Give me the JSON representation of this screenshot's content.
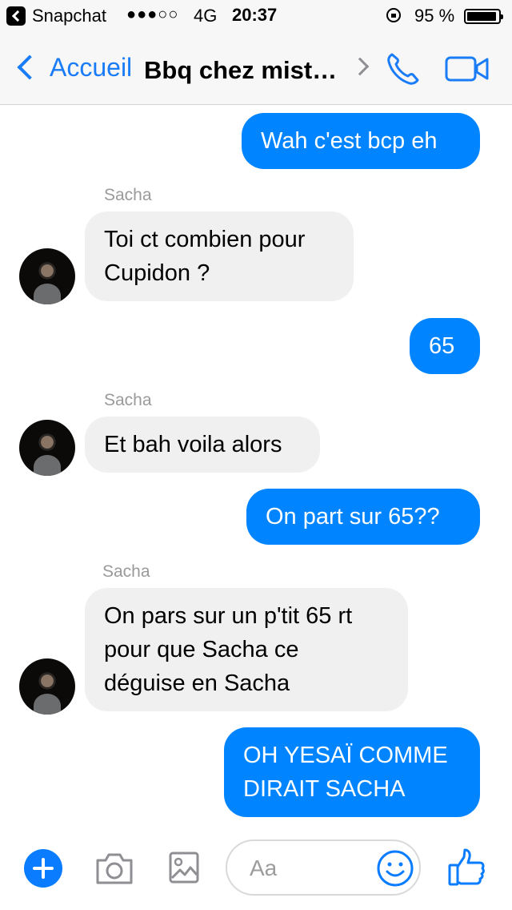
{
  "status": {
    "app": "Snapchat",
    "signal": "●●●○○",
    "network": "4G",
    "time": "20:37",
    "battery_text": "95 %",
    "battery_level": 0.95
  },
  "nav": {
    "back_label": "Accueil",
    "title": "Bbq chez mist…"
  },
  "messages": [
    {
      "direction": "out",
      "text": "Wah c'est bcp eh"
    },
    {
      "direction": "in",
      "sender": "Sacha",
      "lines": [
        "Toi ct combien pour",
        "Cupidon ?"
      ]
    },
    {
      "direction": "out",
      "text": "65"
    },
    {
      "direction": "in",
      "sender": "Sacha",
      "lines": [
        "Et bah voila alors"
      ]
    },
    {
      "direction": "out",
      "text": "On part sur 65??"
    },
    {
      "direction": "in",
      "sender": "Sacha",
      "lines": [
        "On pars sur un p'tit 65 rt",
        "pour que Sacha ce",
        "déguise en Sacha"
      ]
    },
    {
      "direction": "out",
      "lines": [
        "OH YESAÏ COMME",
        "DIRAIT SACHA"
      ]
    }
  ],
  "composer": {
    "placeholder": "Aa"
  },
  "colors": {
    "accent": "#0084ff",
    "incoming_bubble": "#f1f0f0"
  }
}
